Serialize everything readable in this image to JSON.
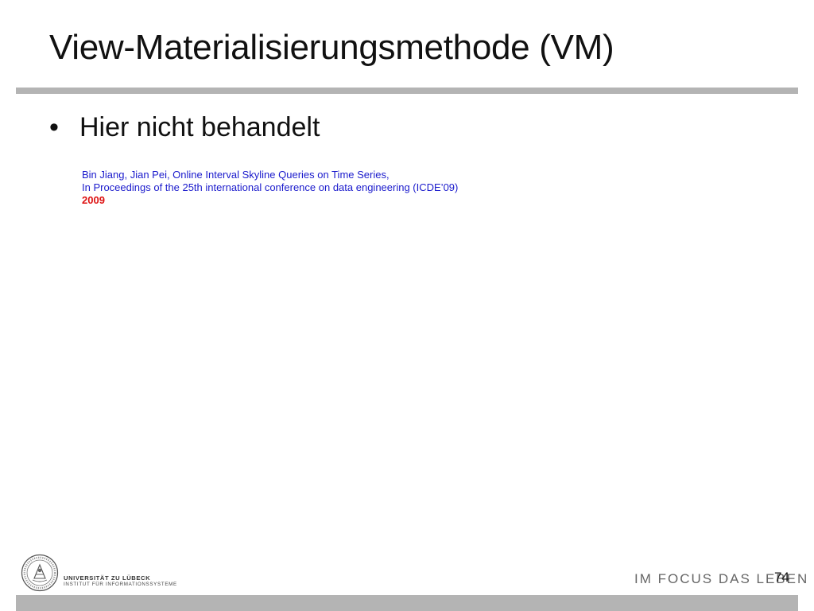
{
  "slide": {
    "title": "View-Materialisierungsmethode (VM)",
    "bullet": "Hier nicht behandelt",
    "bullet_marker": "•",
    "reference": {
      "line1": "Bin Jiang, Jian Pei, Online Interval Skyline Queries on Time  Series,",
      "line2": "In Proceedings of the 25th international conference on data engineering (ICDE’09)",
      "year": "2009"
    }
  },
  "footer": {
    "university": "UNIVERSITÄT ZU LÜBECK",
    "institute": "INSTITUT FÜR INFORMATIONSSYSTEME",
    "slogan": "IM FOCUS DAS LEBEN",
    "page_number": "74"
  },
  "colors": {
    "title": "#111111",
    "rule": "#b4b4b4",
    "reference_text": "#1a1acc",
    "reference_year": "#dd1111",
    "slogan": "#666666"
  },
  "icons": {
    "logo": "university-seal-icon"
  }
}
